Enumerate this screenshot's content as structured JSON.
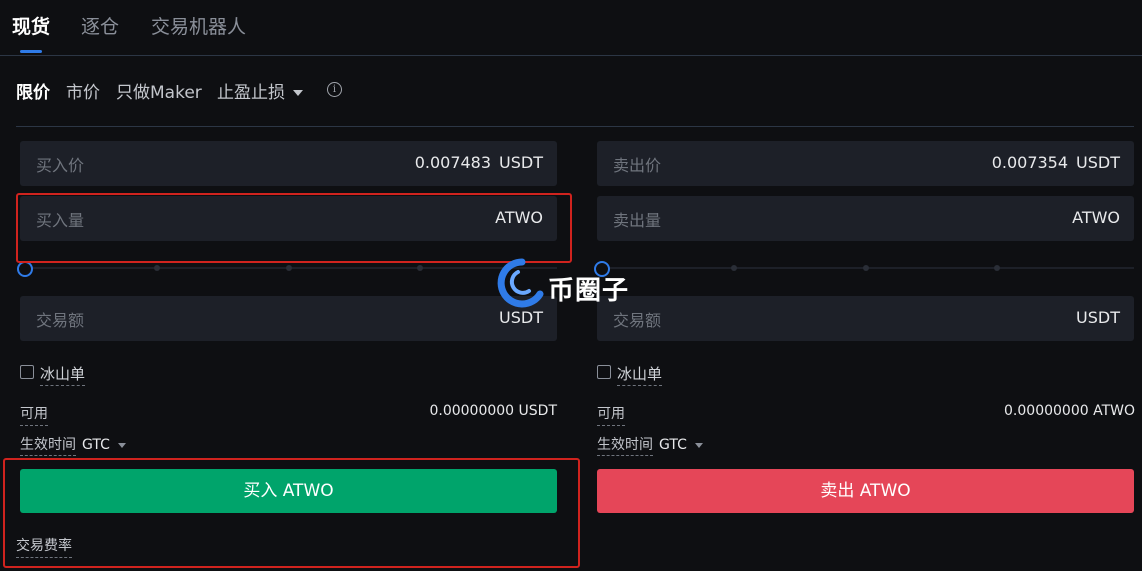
{
  "tabs": [
    {
      "label": "现货",
      "active": true
    },
    {
      "label": "逐仓",
      "active": false
    },
    {
      "label": "交易机器人",
      "active": false
    }
  ],
  "order_types": [
    {
      "label": "限价",
      "active": true
    },
    {
      "label": "市价",
      "active": false
    },
    {
      "label": "只做Maker",
      "active": false
    },
    {
      "label": "止盈止损",
      "active": false,
      "has_dropdown": true
    }
  ],
  "info_icon": "info-icon",
  "buy": {
    "price_label": "买入价",
    "price_value": "0.007483",
    "price_unit": "USDT",
    "amount_label": "买入量",
    "amount_unit": "ATWO",
    "slider_percent": 0,
    "total_label": "交易额",
    "total_unit": "USDT",
    "iceberg_label": "冰山单",
    "available_label": "可用",
    "available_value": "0.00000000 USDT",
    "tif_label": "生效时间",
    "tif_value": "GTC",
    "button_label": "买入 ATWO",
    "fee_label": "交易费率"
  },
  "sell": {
    "price_label": "卖出价",
    "price_value": "0.007354",
    "price_unit": "USDT",
    "amount_label": "卖出量",
    "amount_unit": "ATWO",
    "slider_percent": 0,
    "total_label": "交易额",
    "total_unit": "USDT",
    "iceberg_label": "冰山单",
    "available_label": "可用",
    "available_value": "0.00000000 ATWO",
    "tif_label": "生效时间",
    "tif_value": "GTC",
    "button_label": "卖出 ATWO"
  },
  "watermark": {
    "text": "币圈子"
  },
  "colors": {
    "background": "#0e0f12",
    "input_bg": "#1d2028",
    "accent": "#2f7be8",
    "buy": "#00a46b",
    "sell": "#e54658",
    "highlight_box": "#d0231e"
  }
}
